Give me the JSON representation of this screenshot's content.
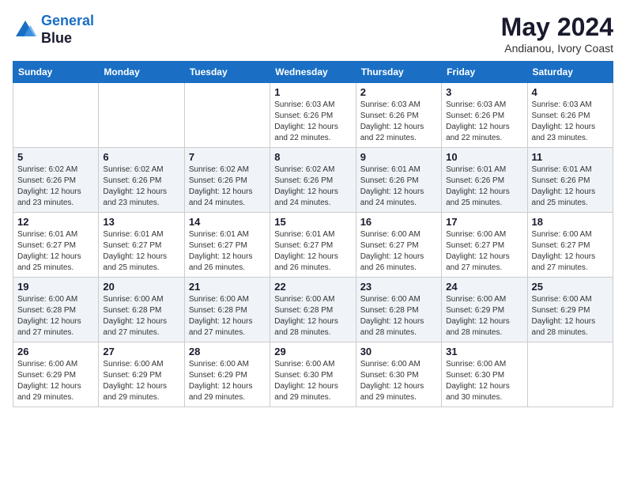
{
  "header": {
    "logo_line1": "General",
    "logo_line2": "Blue",
    "main_title": "May 2024",
    "subtitle": "Andianou, Ivory Coast"
  },
  "days_of_week": [
    "Sunday",
    "Monday",
    "Tuesday",
    "Wednesday",
    "Thursday",
    "Friday",
    "Saturday"
  ],
  "weeks": [
    [
      {
        "day": "",
        "info": ""
      },
      {
        "day": "",
        "info": ""
      },
      {
        "day": "",
        "info": ""
      },
      {
        "day": "1",
        "info": "Sunrise: 6:03 AM\nSunset: 6:26 PM\nDaylight: 12 hours\nand 22 minutes."
      },
      {
        "day": "2",
        "info": "Sunrise: 6:03 AM\nSunset: 6:26 PM\nDaylight: 12 hours\nand 22 minutes."
      },
      {
        "day": "3",
        "info": "Sunrise: 6:03 AM\nSunset: 6:26 PM\nDaylight: 12 hours\nand 22 minutes."
      },
      {
        "day": "4",
        "info": "Sunrise: 6:03 AM\nSunset: 6:26 PM\nDaylight: 12 hours\nand 23 minutes."
      }
    ],
    [
      {
        "day": "5",
        "info": "Sunrise: 6:02 AM\nSunset: 6:26 PM\nDaylight: 12 hours\nand 23 minutes."
      },
      {
        "day": "6",
        "info": "Sunrise: 6:02 AM\nSunset: 6:26 PM\nDaylight: 12 hours\nand 23 minutes."
      },
      {
        "day": "7",
        "info": "Sunrise: 6:02 AM\nSunset: 6:26 PM\nDaylight: 12 hours\nand 24 minutes."
      },
      {
        "day": "8",
        "info": "Sunrise: 6:02 AM\nSunset: 6:26 PM\nDaylight: 12 hours\nand 24 minutes."
      },
      {
        "day": "9",
        "info": "Sunrise: 6:01 AM\nSunset: 6:26 PM\nDaylight: 12 hours\nand 24 minutes."
      },
      {
        "day": "10",
        "info": "Sunrise: 6:01 AM\nSunset: 6:26 PM\nDaylight: 12 hours\nand 25 minutes."
      },
      {
        "day": "11",
        "info": "Sunrise: 6:01 AM\nSunset: 6:26 PM\nDaylight: 12 hours\nand 25 minutes."
      }
    ],
    [
      {
        "day": "12",
        "info": "Sunrise: 6:01 AM\nSunset: 6:27 PM\nDaylight: 12 hours\nand 25 minutes."
      },
      {
        "day": "13",
        "info": "Sunrise: 6:01 AM\nSunset: 6:27 PM\nDaylight: 12 hours\nand 25 minutes."
      },
      {
        "day": "14",
        "info": "Sunrise: 6:01 AM\nSunset: 6:27 PM\nDaylight: 12 hours\nand 26 minutes."
      },
      {
        "day": "15",
        "info": "Sunrise: 6:01 AM\nSunset: 6:27 PM\nDaylight: 12 hours\nand 26 minutes."
      },
      {
        "day": "16",
        "info": "Sunrise: 6:00 AM\nSunset: 6:27 PM\nDaylight: 12 hours\nand 26 minutes."
      },
      {
        "day": "17",
        "info": "Sunrise: 6:00 AM\nSunset: 6:27 PM\nDaylight: 12 hours\nand 27 minutes."
      },
      {
        "day": "18",
        "info": "Sunrise: 6:00 AM\nSunset: 6:27 PM\nDaylight: 12 hours\nand 27 minutes."
      }
    ],
    [
      {
        "day": "19",
        "info": "Sunrise: 6:00 AM\nSunset: 6:28 PM\nDaylight: 12 hours\nand 27 minutes."
      },
      {
        "day": "20",
        "info": "Sunrise: 6:00 AM\nSunset: 6:28 PM\nDaylight: 12 hours\nand 27 minutes."
      },
      {
        "day": "21",
        "info": "Sunrise: 6:00 AM\nSunset: 6:28 PM\nDaylight: 12 hours\nand 27 minutes."
      },
      {
        "day": "22",
        "info": "Sunrise: 6:00 AM\nSunset: 6:28 PM\nDaylight: 12 hours\nand 28 minutes."
      },
      {
        "day": "23",
        "info": "Sunrise: 6:00 AM\nSunset: 6:28 PM\nDaylight: 12 hours\nand 28 minutes."
      },
      {
        "day": "24",
        "info": "Sunrise: 6:00 AM\nSunset: 6:29 PM\nDaylight: 12 hours\nand 28 minutes."
      },
      {
        "day": "25",
        "info": "Sunrise: 6:00 AM\nSunset: 6:29 PM\nDaylight: 12 hours\nand 28 minutes."
      }
    ],
    [
      {
        "day": "26",
        "info": "Sunrise: 6:00 AM\nSunset: 6:29 PM\nDaylight: 12 hours\nand 29 minutes."
      },
      {
        "day": "27",
        "info": "Sunrise: 6:00 AM\nSunset: 6:29 PM\nDaylight: 12 hours\nand 29 minutes."
      },
      {
        "day": "28",
        "info": "Sunrise: 6:00 AM\nSunset: 6:29 PM\nDaylight: 12 hours\nand 29 minutes."
      },
      {
        "day": "29",
        "info": "Sunrise: 6:00 AM\nSunset: 6:30 PM\nDaylight: 12 hours\nand 29 minutes."
      },
      {
        "day": "30",
        "info": "Sunrise: 6:00 AM\nSunset: 6:30 PM\nDaylight: 12 hours\nand 29 minutes."
      },
      {
        "day": "31",
        "info": "Sunrise: 6:00 AM\nSunset: 6:30 PM\nDaylight: 12 hours\nand 30 minutes."
      },
      {
        "day": "",
        "info": ""
      }
    ]
  ]
}
